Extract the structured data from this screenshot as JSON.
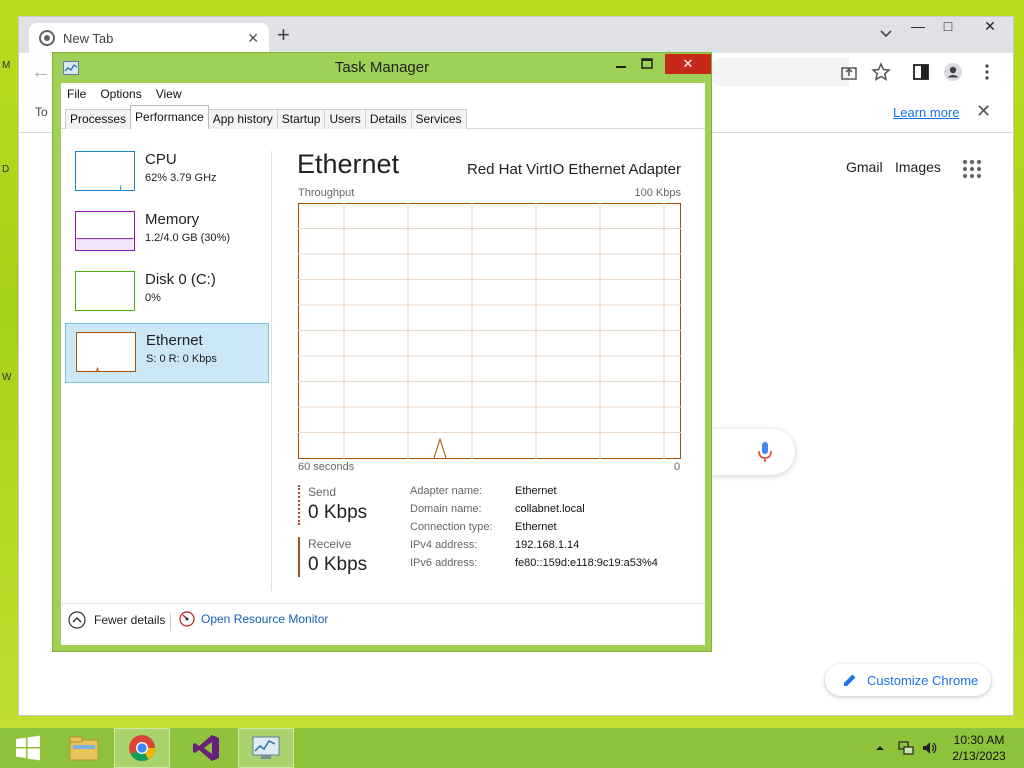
{
  "desktop": {
    "edge_letters": [
      "M",
      "D",
      "W"
    ]
  },
  "chrome": {
    "tab_title": "New Tab",
    "infobar_text": "To",
    "learn_more": "Learn more",
    "header_links": {
      "gmail": "Gmail",
      "images": "Images"
    },
    "customize_label": "Customize Chrome"
  },
  "taskmanager": {
    "title": "Task Manager",
    "menu": [
      "File",
      "Options",
      "View"
    ],
    "tabs": [
      "Processes",
      "Performance",
      "App history",
      "Startup",
      "Users",
      "Details",
      "Services"
    ],
    "active_tab": "Performance",
    "resources": [
      {
        "name": "CPU",
        "detail": "62%  3.79 GHz",
        "color": "#1783c9"
      },
      {
        "name": "Memory",
        "detail": "1.2/4.0 GB (30%)",
        "color": "#8b12ae"
      },
      {
        "name": "Disk 0 (C:)",
        "detail": "0%",
        "color": "#4da60c"
      },
      {
        "name": "Ethernet",
        "detail": "S: 0  R: 0 Kbps",
        "color": "#a74f01"
      }
    ],
    "selected": "Ethernet",
    "detail": {
      "heading": "Ethernet",
      "adapter": "Red Hat VirtIO Ethernet Adapter",
      "throughput_label": "Throughput",
      "max_label": "100 Kbps",
      "time_label": "60 seconds",
      "min_label": "0",
      "send_label": "Send",
      "send_value": "0 Kbps",
      "receive_label": "Receive",
      "receive_value": "0 Kbps",
      "properties": [
        {
          "key": "Adapter name:",
          "value": "Ethernet"
        },
        {
          "key": "Domain name:",
          "value": "collabnet.local"
        },
        {
          "key": "Connection type:",
          "value": "Ethernet"
        },
        {
          "key": "IPv4 address:",
          "value": "192.168.1.14"
        },
        {
          "key": "IPv6 address:",
          "value": "fe80::159d:e118:9c19:a53%4"
        }
      ]
    },
    "footer": {
      "fewer_details": "Fewer details",
      "open_monitor": "Open Resource Monitor"
    }
  },
  "taskbar": {
    "clock_time": "10:30 AM",
    "clock_date": "2/13/2023",
    "pinned": [
      "start-icon",
      "file-explorer-icon",
      "chrome-icon",
      "visual-studio-icon",
      "task-manager-icon"
    ]
  }
}
